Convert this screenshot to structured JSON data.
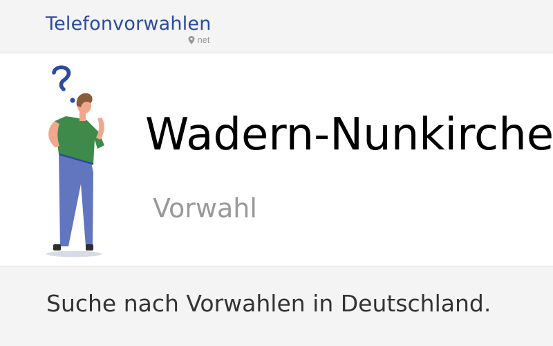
{
  "header": {
    "logo_text": "Telefonvorwahlen",
    "logo_suffix": "net",
    "logo_color": "#2b4aa0",
    "pin_icon": "map-pin-icon"
  },
  "hero": {
    "title": "Wadern-Nunkirchen",
    "subtitle": "Vorwahl",
    "illustration": "thinking-person-with-question-mark"
  },
  "footer": {
    "search_text": "Suche nach Vorwahlen in Deutschland."
  }
}
